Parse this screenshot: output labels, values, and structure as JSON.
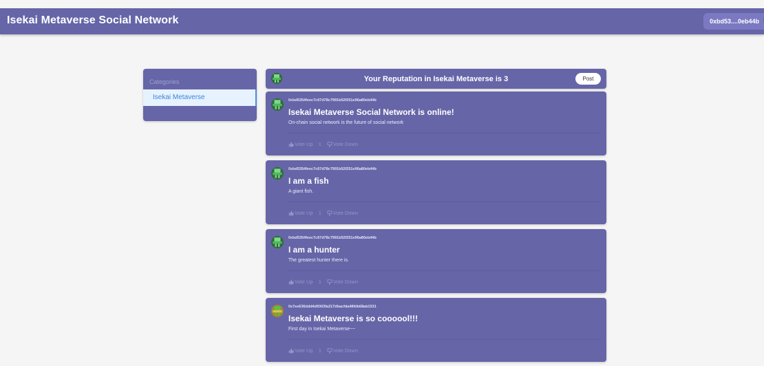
{
  "app": {
    "title": "Isekai Metaverse Social Network"
  },
  "wallet": {
    "address": "0xbd53....0eb44b"
  },
  "categories": {
    "header": "Categories",
    "items": [
      {
        "label": "Isekai Metaverse"
      }
    ]
  },
  "reputation": {
    "text": "Your Reputation in Isekai Metaverse is 3",
    "post_button": "Post"
  },
  "posts": [
    {
      "author": "0xbd5354feec7c67d78c7991b52f251e96a80eb44b",
      "title": "Isekai Metaverse Social Network is online!",
      "body": "On-chain social network is the future of social network",
      "vote_up_label": "Vote Up",
      "votes": "1",
      "vote_down_label": "Vote Down"
    },
    {
      "author": "0xbd5354feec7c67d78c7991b52f251e96a80eb44b",
      "title": "I am a fish",
      "body": "A giant fish.",
      "vote_up_label": "Vote Up",
      "votes": "1",
      "vote_down_label": "Vote Down"
    },
    {
      "author": "0xbd5354feec7c67d78c7991b52f251e96a80eb44b",
      "title": "I am a hunter",
      "body": "The greatest hunter there is.",
      "vote_up_label": "Vote Up",
      "votes": "1",
      "vote_down_label": "Vote Down"
    },
    {
      "author": "0x7ee636ddd4d9303fa217dbacfda48fdb68ab1531",
      "title": "Isekai Metaverse is so coooool!!!",
      "body": "First day in Isekai Metaverse~~",
      "vote_up_label": "Vote Up",
      "votes": "1",
      "vote_down_label": "Vote Down"
    }
  ],
  "colors": {
    "primary": "#6665a8",
    "background": "#f5f5f5",
    "selected_bg": "#e6f2fd",
    "selected_text": "#3c84dc"
  }
}
